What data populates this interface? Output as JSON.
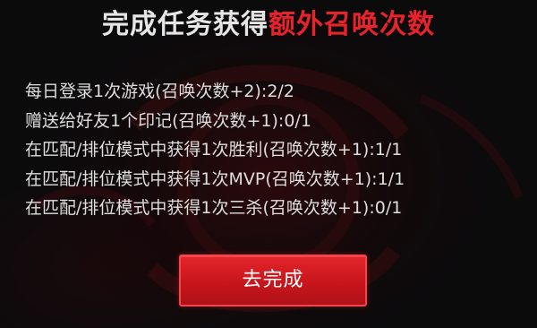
{
  "title": {
    "prefix": "完成任务获得",
    "highlight": "额外召唤次数"
  },
  "tasks": [
    "每日登录1次游戏(召唤次数+2):2/2",
    "赠送给好友1个印记(召唤次数+1):0/1",
    "在匹配/排位模式中获得1次胜利(召唤次数+1):1/1",
    "在匹配/排位模式中获得1次MVP(召唤次数+1):1/1",
    "在匹配/排位模式中获得1次三杀(召唤次数+1):0/1"
  ],
  "button": {
    "label": "去完成"
  },
  "colors": {
    "accent_red": "#e8232c",
    "text": "#dedede",
    "background": "#0b0b0c"
  }
}
